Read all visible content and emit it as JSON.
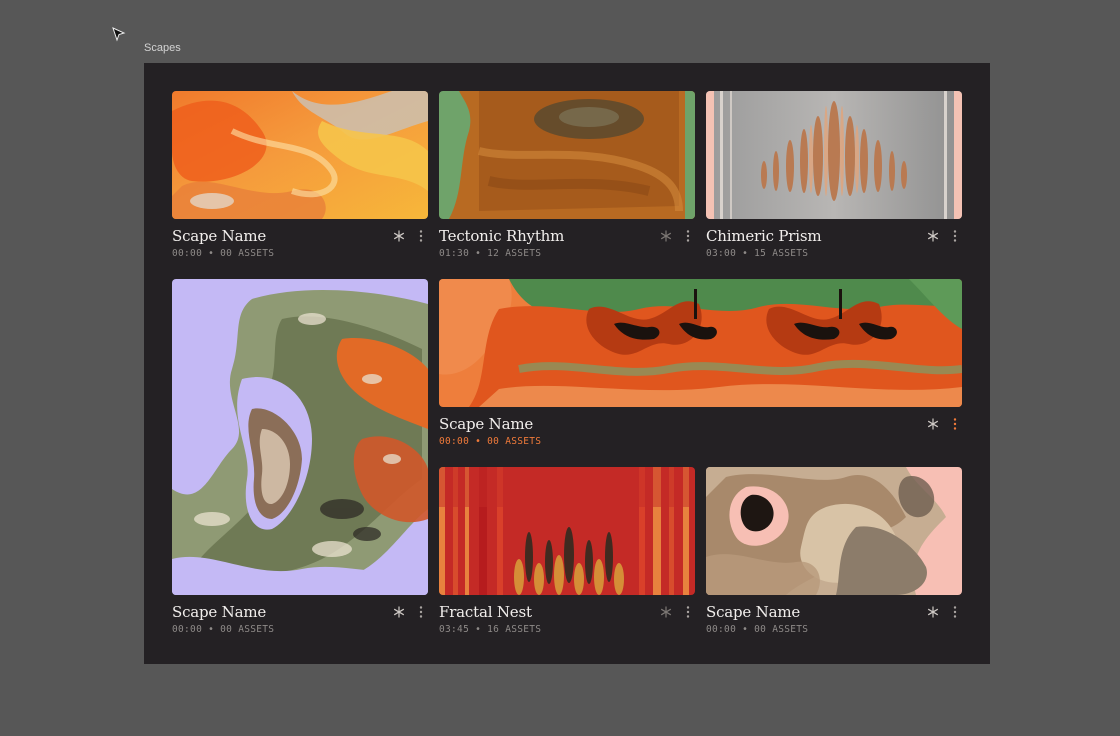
{
  "window": {
    "label": "Scapes"
  },
  "colors": {
    "panel": "#242124",
    "background": "#575757",
    "accent": "#f07a3a",
    "title": "#f1eeec",
    "subtitle": "#8e8a88"
  },
  "icons": {
    "favorite": "asterisk-icon",
    "more": "more-vertical-icon",
    "cursor": "arrow-cursor-icon"
  },
  "cards": [
    {
      "title": "Scape Name",
      "subtitle": "00:00 • 00 ASSETS",
      "active": false
    },
    {
      "title": "Tectonic Rhythm",
      "subtitle": "01:30 • 12 ASSETS",
      "active": false
    },
    {
      "title": "Chimeric Prism",
      "subtitle": "03:00 • 15 ASSETS",
      "active": false
    },
    {
      "title": "Scape Name",
      "subtitle": "00:00 • 00 ASSETS",
      "active": false
    },
    {
      "title": "Scape Name",
      "subtitle": "00:00 • 00 ASSETS",
      "active": true
    },
    {
      "title": "Fractal Nest",
      "subtitle": "03:45 • 16 ASSETS",
      "active": false
    },
    {
      "title": "Scape Name",
      "subtitle": "00:00 • 00 ASSETS",
      "active": false
    }
  ]
}
